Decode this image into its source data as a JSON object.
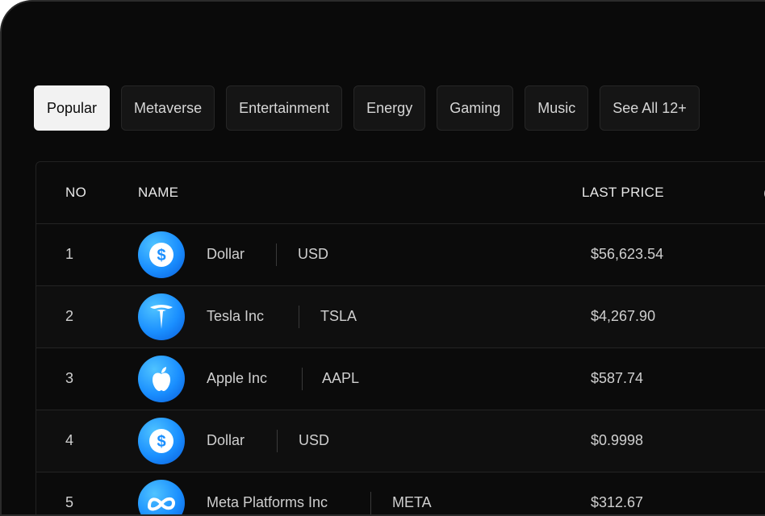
{
  "tabs": [
    {
      "label": "Popular",
      "active": true
    },
    {
      "label": "Metaverse",
      "active": false
    },
    {
      "label": "Entertainment",
      "active": false
    },
    {
      "label": "Energy",
      "active": false
    },
    {
      "label": "Gaming",
      "active": false
    },
    {
      "label": "Music",
      "active": false
    },
    {
      "label": "See All 12+",
      "active": false
    }
  ],
  "table": {
    "headers": {
      "no": "NO",
      "name": "NAME",
      "price": "LAST PRICE"
    },
    "rows": [
      {
        "no": "1",
        "icon": "dollar-icon",
        "name": "Dollar",
        "symbol": "USD",
        "price": "$56,623.54"
      },
      {
        "no": "2",
        "icon": "tesla-icon",
        "name": "Tesla Inc",
        "symbol": "TSLA",
        "price": "$4,267.90"
      },
      {
        "no": "3",
        "icon": "apple-icon",
        "name": "Apple Inc",
        "symbol": "AAPL",
        "price": "$587.74"
      },
      {
        "no": "4",
        "icon": "dollar-icon",
        "name": "Dollar",
        "symbol": "USD",
        "price": "$0.9998"
      },
      {
        "no": "5",
        "icon": "meta-icon",
        "name": "Meta Platforms Inc",
        "symbol": "META",
        "price": "$312.67"
      }
    ]
  },
  "colors": {
    "background": "#0a0a0a",
    "active_tab": "#f2f2f2",
    "accent": "#1a8fff"
  }
}
